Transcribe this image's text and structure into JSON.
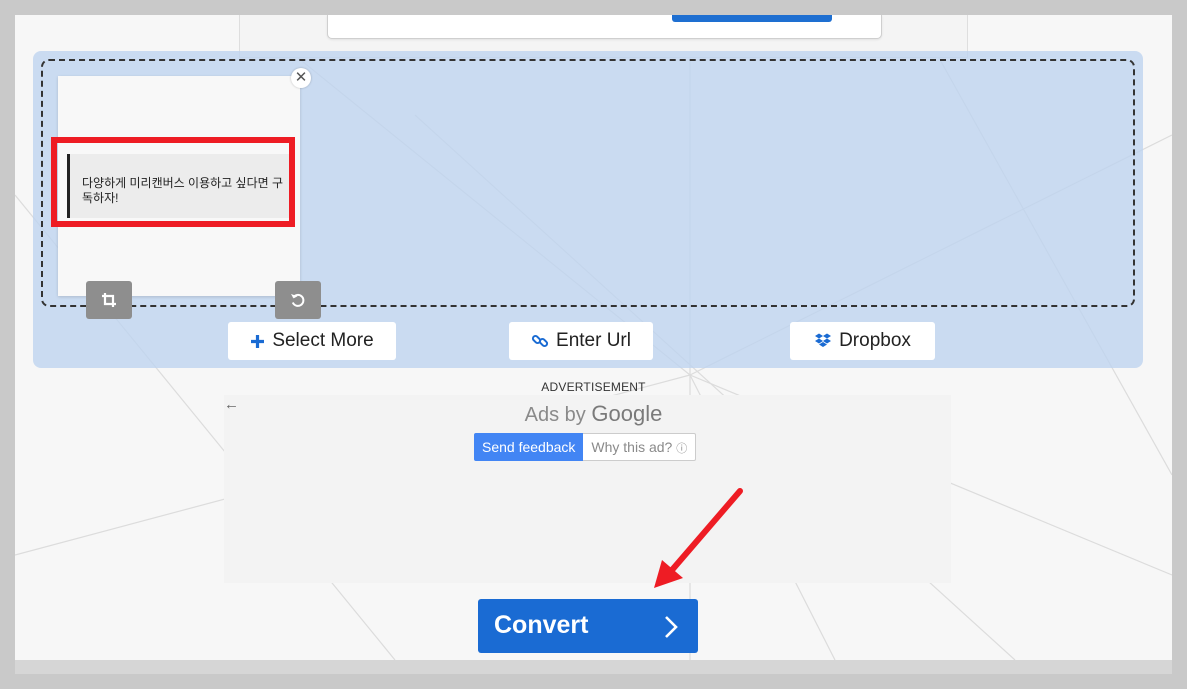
{
  "thumbnail": {
    "preview_text": "다양하게 미리캔버스 이용하고 싶다면 구독하자!"
  },
  "buttons": {
    "select_more": "Select More",
    "enter_url": "Enter Url",
    "dropbox": "Dropbox",
    "convert": "Convert"
  },
  "ad": {
    "label": "ADVERTISEMENT",
    "ads_by": "Ads by",
    "google": "Google",
    "send_feedback": "Send feedback",
    "why_this_ad": "Why this ad?"
  },
  "icons": [
    "close-icon",
    "crop-icon",
    "rotate-icon",
    "plus-icon",
    "link-icon",
    "dropbox-icon",
    "back-arrow-icon",
    "info-icon",
    "chevron-right-icon"
  ],
  "colors": {
    "accent": "#1a6bd3",
    "feedback_blue": "#4285f4",
    "highlight_red": "#ee1c24",
    "upload_area": "#bed4f0"
  }
}
